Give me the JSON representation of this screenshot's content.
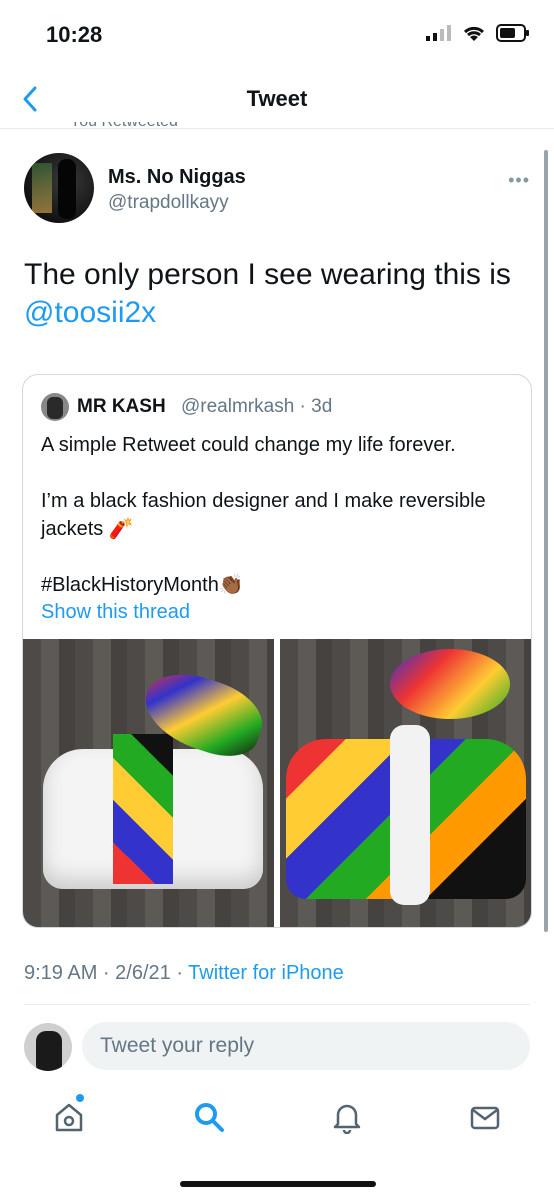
{
  "status": {
    "time": "10:28"
  },
  "nav": {
    "title": "Tweet"
  },
  "retweet_label": "You Retweeted",
  "tweet": {
    "name": "Ms. No Niggas",
    "handle": "@trapdollkayy",
    "text": "The only person I see wearing this is",
    "mention": "@toosii2x"
  },
  "quote": {
    "name": "MR KASH",
    "handle": "@realmrkash · 3d",
    "text": "A simple Retweet could change my life forever.\n\nI’m a black fashion designer and I make reversible jackets 🧨\n\n#BlackHistoryMonth👏🏾",
    "link": "Show this thread"
  },
  "meta": {
    "datetime": "9:19 AM · 2/6/21 · ",
    "source": "Twitter for iPhone"
  },
  "reply": {
    "placeholder": "Tweet your reply"
  },
  "colors": {
    "accent": "#1d9bf0",
    "secondary_text": "#657786"
  },
  "tabs": [
    "home-icon",
    "search-icon",
    "notifications-icon",
    "messages-icon"
  ]
}
